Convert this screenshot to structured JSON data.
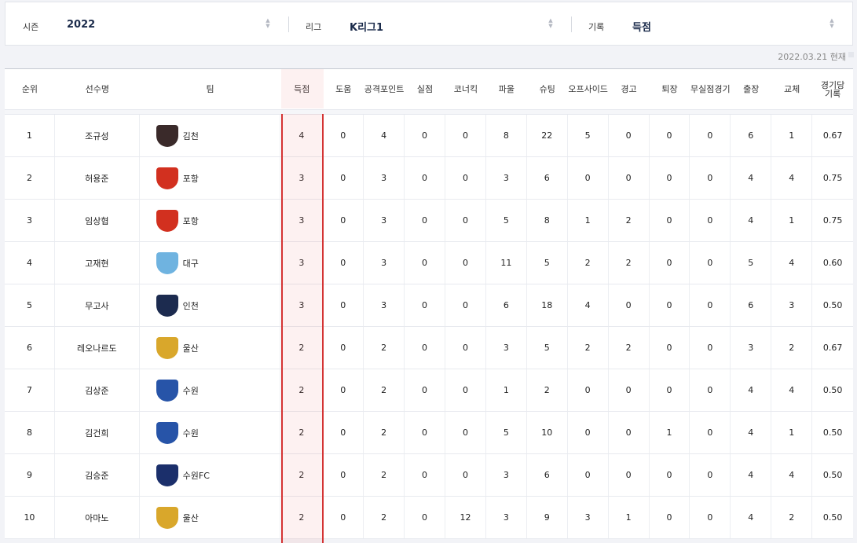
{
  "filters": {
    "season_label": "시즌",
    "season_value": "2022",
    "league_label": "리그",
    "league_value": "K리그1",
    "record_label": "기록",
    "record_value": "득점"
  },
  "date_stamp": "2022.03.21 현재",
  "table": {
    "headers": [
      "순위",
      "선수명",
      "팀",
      "득점",
      "도움",
      "공격포인트",
      "실점",
      "코너킥",
      "파울",
      "슈팅",
      "오프사이드",
      "경고",
      "퇴장",
      "무실점경기",
      "출장",
      "교체",
      "경기당 기록"
    ],
    "rows": [
      {
        "rank": "1",
        "player": "조규성",
        "team": "김천",
        "team_color": "#3a2a2a",
        "goals": "4",
        "assists": "0",
        "points": "4",
        "conceded": "0",
        "corners": "0",
        "fouls": "8",
        "shots": "22",
        "offside": "5",
        "yellow": "0",
        "red": "0",
        "clean": "0",
        "apps": "6",
        "subs": "1",
        "per_game": "0.67"
      },
      {
        "rank": "2",
        "player": "허용준",
        "team": "포항",
        "team_color": "#d2301f",
        "goals": "3",
        "assists": "0",
        "points": "3",
        "conceded": "0",
        "corners": "0",
        "fouls": "3",
        "shots": "6",
        "offside": "0",
        "yellow": "0",
        "red": "0",
        "clean": "0",
        "apps": "4",
        "subs": "4",
        "per_game": "0.75"
      },
      {
        "rank": "3",
        "player": "임상협",
        "team": "포항",
        "team_color": "#d2301f",
        "goals": "3",
        "assists": "0",
        "points": "3",
        "conceded": "0",
        "corners": "0",
        "fouls": "5",
        "shots": "8",
        "offside": "1",
        "yellow": "2",
        "red": "0",
        "clean": "0",
        "apps": "4",
        "subs": "1",
        "per_game": "0.75"
      },
      {
        "rank": "4",
        "player": "고재현",
        "team": "대구",
        "team_color": "#6fb3e0",
        "goals": "3",
        "assists": "0",
        "points": "3",
        "conceded": "0",
        "corners": "0",
        "fouls": "11",
        "shots": "5",
        "offside": "2",
        "yellow": "2",
        "red": "0",
        "clean": "0",
        "apps": "5",
        "subs": "4",
        "per_game": "0.60"
      },
      {
        "rank": "5",
        "player": "무고사",
        "team": "인천",
        "team_color": "#1c2b4f",
        "goals": "3",
        "assists": "0",
        "points": "3",
        "conceded": "0",
        "corners": "0",
        "fouls": "6",
        "shots": "18",
        "offside": "4",
        "yellow": "0",
        "red": "0",
        "clean": "0",
        "apps": "6",
        "subs": "3",
        "per_game": "0.50"
      },
      {
        "rank": "6",
        "player": "레오나르도",
        "team": "울산",
        "team_color": "#d9a72b",
        "goals": "2",
        "assists": "0",
        "points": "2",
        "conceded": "0",
        "corners": "0",
        "fouls": "3",
        "shots": "5",
        "offside": "2",
        "yellow": "2",
        "red": "0",
        "clean": "0",
        "apps": "3",
        "subs": "2",
        "per_game": "0.67"
      },
      {
        "rank": "7",
        "player": "김상준",
        "team": "수원",
        "team_color": "#2754a8",
        "goals": "2",
        "assists": "0",
        "points": "2",
        "conceded": "0",
        "corners": "0",
        "fouls": "1",
        "shots": "2",
        "offside": "0",
        "yellow": "0",
        "red": "0",
        "clean": "0",
        "apps": "4",
        "subs": "4",
        "per_game": "0.50"
      },
      {
        "rank": "8",
        "player": "김건희",
        "team": "수원",
        "team_color": "#2754a8",
        "goals": "2",
        "assists": "0",
        "points": "2",
        "conceded": "0",
        "corners": "0",
        "fouls": "5",
        "shots": "10",
        "offside": "0",
        "yellow": "0",
        "red": "1",
        "clean": "0",
        "apps": "4",
        "subs": "1",
        "per_game": "0.50"
      },
      {
        "rank": "9",
        "player": "김승준",
        "team": "수원FC",
        "team_color": "#1b2f6b",
        "goals": "2",
        "assists": "0",
        "points": "2",
        "conceded": "0",
        "corners": "0",
        "fouls": "3",
        "shots": "6",
        "offside": "0",
        "yellow": "0",
        "red": "0",
        "clean": "0",
        "apps": "4",
        "subs": "4",
        "per_game": "0.50"
      },
      {
        "rank": "10",
        "player": "아마노",
        "team": "울산",
        "team_color": "#d9a72b",
        "goals": "2",
        "assists": "0",
        "points": "2",
        "conceded": "0",
        "corners": "12",
        "fouls": "3",
        "shots": "9",
        "offside": "3",
        "yellow": "1",
        "red": "0",
        "clean": "0",
        "apps": "4",
        "subs": "2",
        "per_game": "0.50"
      }
    ]
  }
}
